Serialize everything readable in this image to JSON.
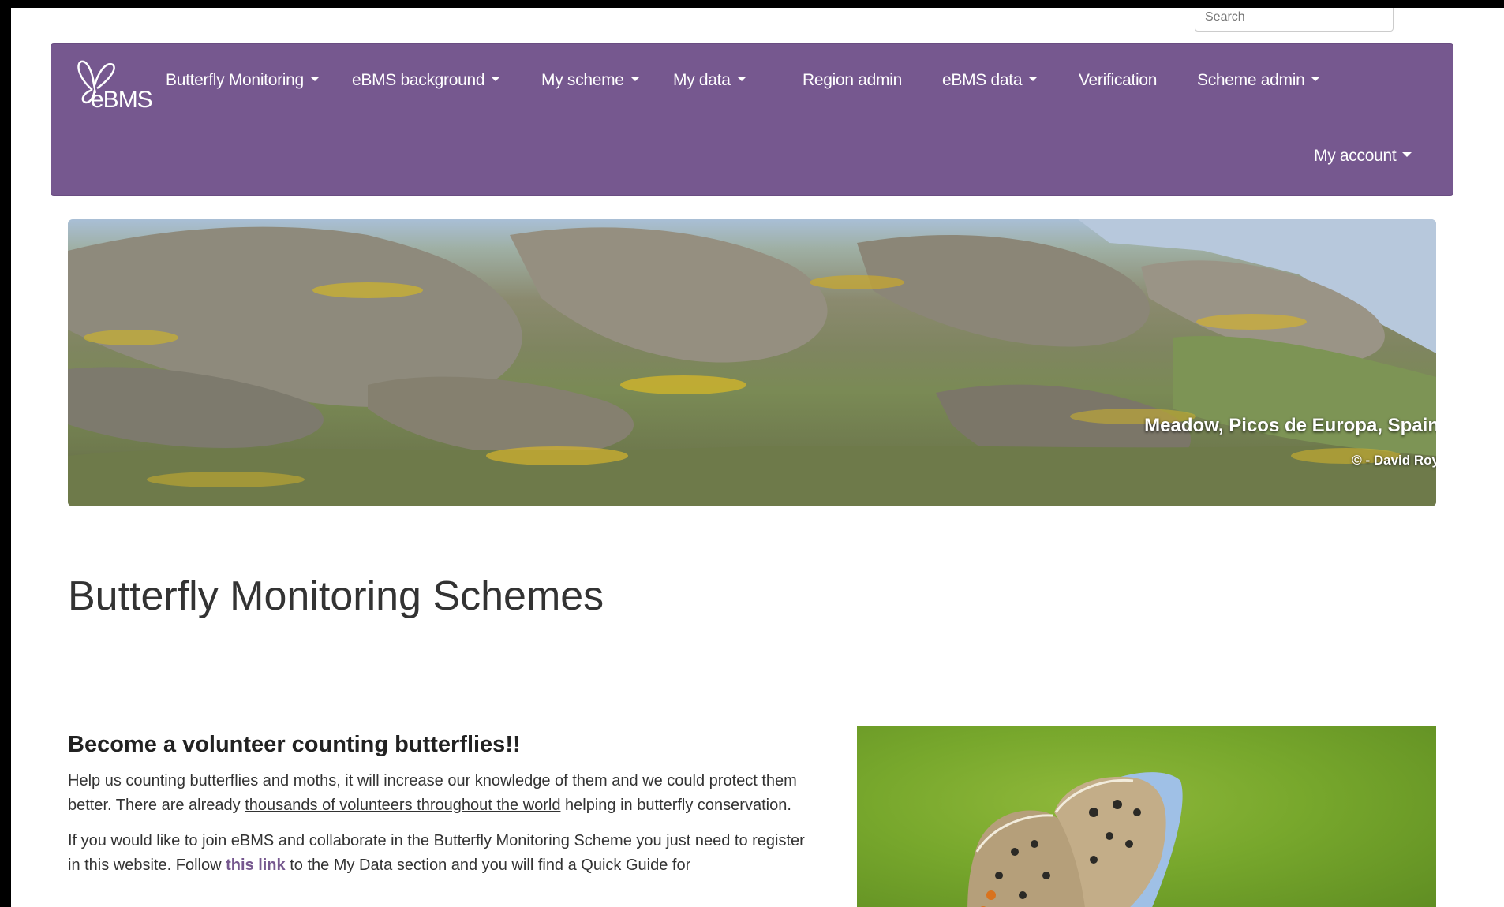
{
  "search": {
    "placeholder": "Search"
  },
  "brand": {
    "name": "eBMS"
  },
  "nav": {
    "items": [
      {
        "label": "Butterfly Monitoring",
        "dropdown": true
      },
      {
        "label": "eBMS background",
        "dropdown": true
      },
      {
        "label": "My scheme",
        "dropdown": true
      },
      {
        "label": "My data",
        "dropdown": true
      },
      {
        "label": "Region admin",
        "dropdown": false
      },
      {
        "label": "eBMS data",
        "dropdown": true
      },
      {
        "label": "Verification",
        "dropdown": false
      },
      {
        "label": "Scheme admin",
        "dropdown": true
      }
    ],
    "account": {
      "label": "My account",
      "dropdown": true
    }
  },
  "hero": {
    "caption": "Meadow, Picos de Europa, Spain",
    "credit": "© - David Roy"
  },
  "page": {
    "title": "Butterfly Monitoring Schemes"
  },
  "volunteer": {
    "heading": "Become a volunteer counting butterflies!!",
    "para1_before": "Help us counting butterflies and moths, it will increase our knowledge of them and we could protect them better. There are already ",
    "para1_link": "thousands of volunteers throughout the world",
    "para1_after": " helping in butterfly conservation.",
    "para2_before": "If you would like to join eBMS and collaborate in the Butterfly Monitoring Scheme you just need to register in this website. Follow ",
    "para2_link": "this link",
    "para2_after": " to the My Data section and you will find a Quick Guide for"
  },
  "colors": {
    "navbar": "#76588f",
    "link": "#76588f"
  },
  "icons": {
    "brand_logo": "butterfly-logo-icon",
    "dropdown": "caret-down-icon"
  }
}
